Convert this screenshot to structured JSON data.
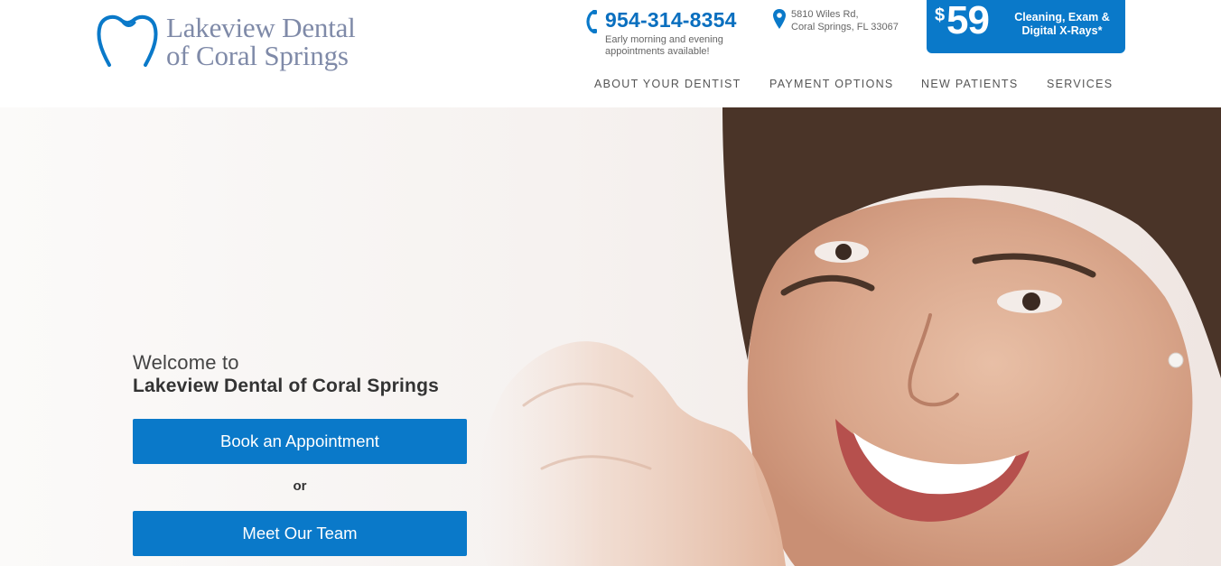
{
  "header": {
    "logo": {
      "line1": "Lakeview Dental",
      "line2": "of Coral Springs"
    },
    "phone": {
      "number": "954-314-8354",
      "note": "Early morning and evening appointments available!"
    },
    "address": {
      "line1": "5810 Wiles Rd,",
      "line2": "Coral Springs, FL 33067"
    },
    "promo": {
      "dollar": "$",
      "price": "59",
      "text": "Cleaning, Exam & Digital X-Rays*"
    },
    "nav": [
      "ABOUT YOUR DENTIST",
      "PAYMENT OPTIONS",
      "NEW PATIENTS",
      "SERVICES"
    ]
  },
  "hero": {
    "welcome_line1": "Welcome to",
    "welcome_line2": "Lakeview Dental of Coral Springs",
    "book_button": "Book an Appointment",
    "or_text": "or",
    "team_button": "Meet Our Team"
  },
  "colors": {
    "brand_blue": "#0a79c9",
    "logo_gray": "#7f8aa8",
    "nav_text": "#555555"
  }
}
